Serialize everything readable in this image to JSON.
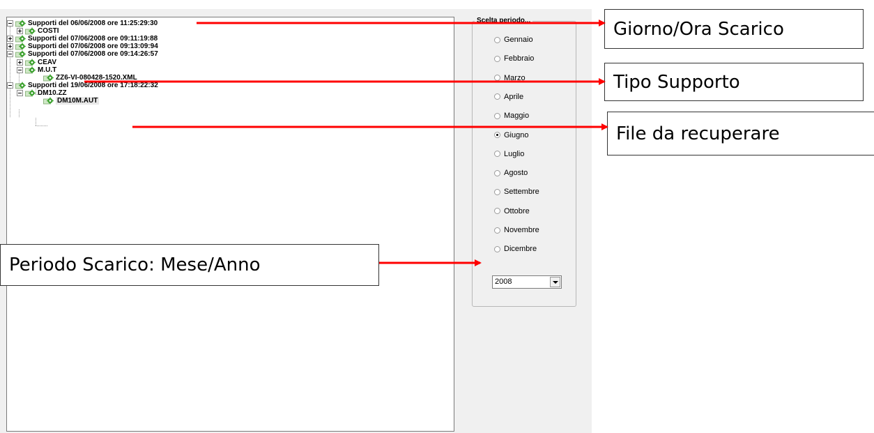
{
  "tree": {
    "nodes": [
      {
        "label": "Supporti del 06/06/2008 ore 11:25:29:30",
        "expander": "minus"
      },
      {
        "label": "COSTI",
        "expander": "plus"
      },
      {
        "label": "Supporti del 07/06/2008 ore 09:11:19:88",
        "expander": "plus"
      },
      {
        "label": "Supporti del 07/06/2008 ore 09:13:09:94",
        "expander": "plus"
      },
      {
        "label": "Supporti del 07/06/2008 ore 09:14:26:57",
        "expander": "minus"
      },
      {
        "label": "CEAV",
        "expander": "plus"
      },
      {
        "label": "M.U.T",
        "expander": "minus"
      },
      {
        "label": "ZZ6-VI-080428-1520.XML",
        "expander": "none"
      },
      {
        "label": "Supporti del 19/06/2008 ore 17:18:22:32",
        "expander": "minus"
      },
      {
        "label": "DM10.ZZ",
        "expander": "minus"
      },
      {
        "label": "DM10M.AUT",
        "expander": "none",
        "selected": true
      }
    ],
    "icon": "gear-folder-icon",
    "icon_color": "#3aa02c"
  },
  "period": {
    "title": "Scelta periodo...",
    "months": [
      {
        "label": "Gennaio",
        "checked": false
      },
      {
        "label": "Febbraio",
        "checked": false
      },
      {
        "label": "Marzo",
        "checked": false
      },
      {
        "label": "Aprile",
        "checked": false
      },
      {
        "label": "Maggio",
        "checked": false
      },
      {
        "label": "Giugno",
        "checked": true
      },
      {
        "label": "Luglio",
        "checked": false
      },
      {
        "label": "Agosto",
        "checked": false
      },
      {
        "label": "Settembre",
        "checked": false
      },
      {
        "label": "Ottobre",
        "checked": false
      },
      {
        "label": "Novembre",
        "checked": false
      },
      {
        "label": "Dicembre",
        "checked": false
      }
    ],
    "year": "2008"
  },
  "callouts": {
    "download_datetime": "Giorno/Ora Scarico",
    "media_type": "Tipo Supporto",
    "file_to_recover": "File da recuperare",
    "download_period": "Periodo Scarico: Mese/Anno"
  },
  "colors": {
    "arrow": "#ff0000",
    "window_bg": "#f0f0f0"
  }
}
